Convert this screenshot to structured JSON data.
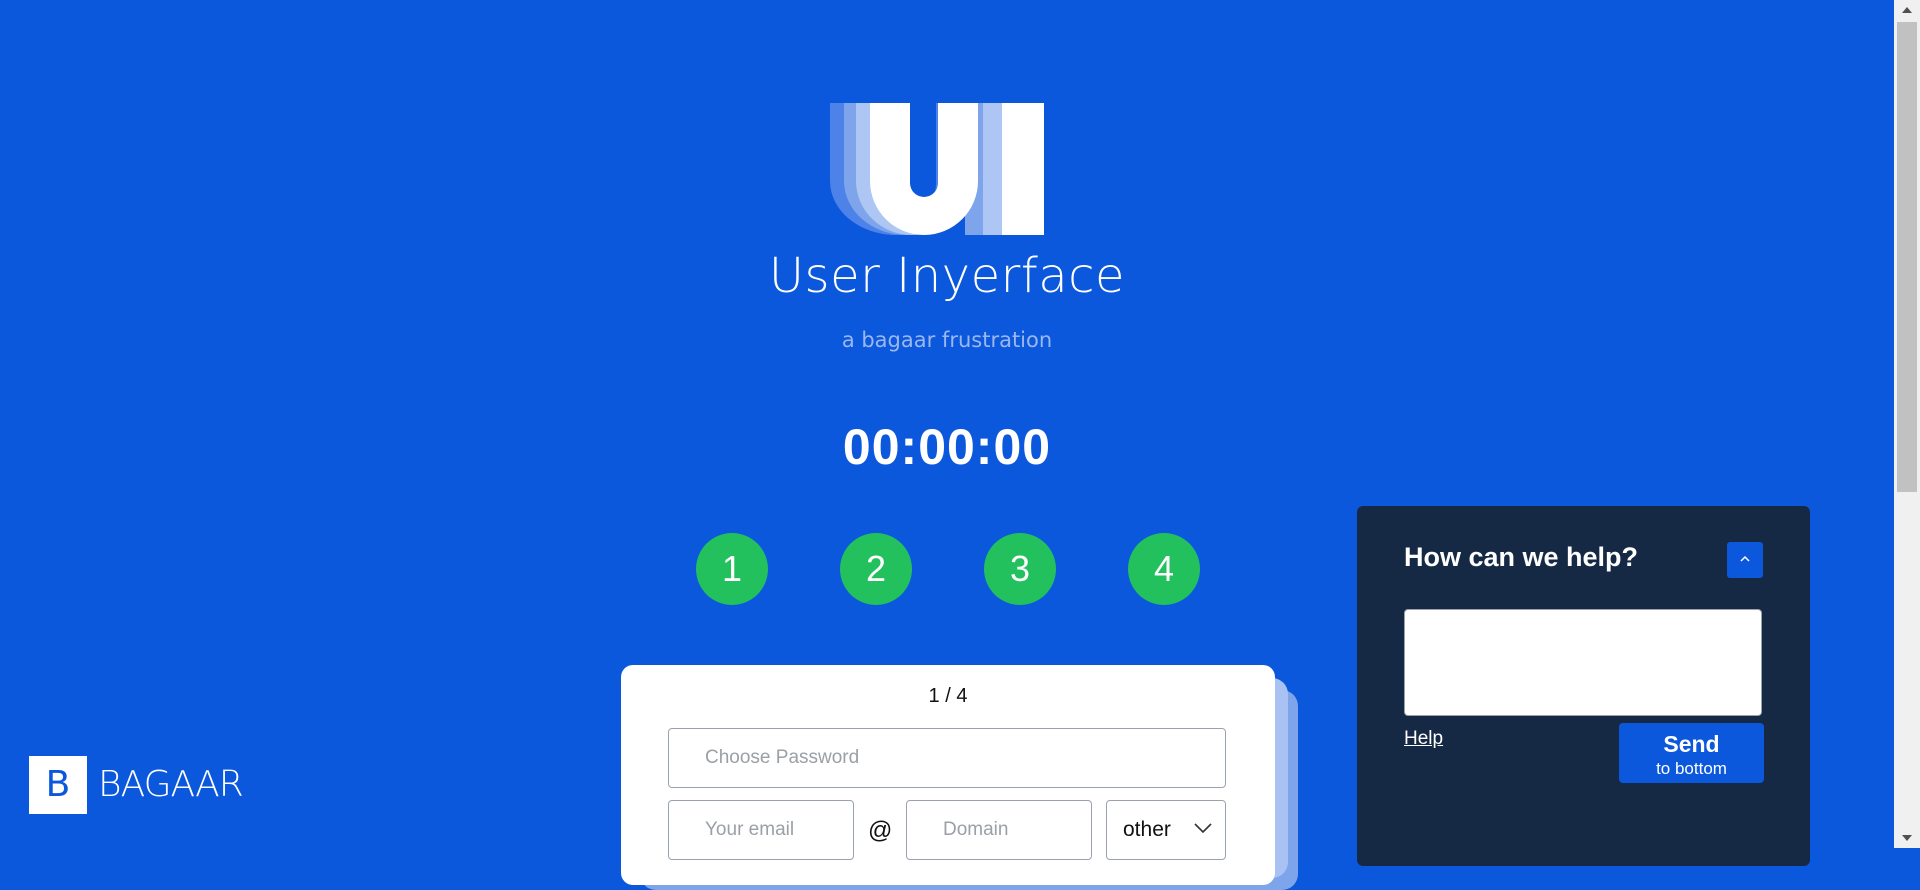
{
  "header": {
    "logo_text": "UI",
    "title": "User Inyerface",
    "subtitle": "a bagaar frustration"
  },
  "timer": "00:00:00",
  "steps": [
    "1",
    "2",
    "3",
    "4"
  ],
  "form": {
    "pager": "1 / 4",
    "password_placeholder": "Choose Password",
    "email_placeholder": "Your email",
    "at_sign": "@",
    "domain_placeholder": "Domain",
    "tld_selected": "other"
  },
  "help": {
    "title": "How can we help?",
    "link": "Help",
    "send_label": "Send",
    "send_sublabel": "to bottom"
  },
  "brand": {
    "box_letter": "B",
    "name": "BAGAAR"
  },
  "colors": {
    "background": "#0c58dd",
    "step": "#22c15d",
    "help_panel": "#152944"
  },
  "icons": {
    "help_toggle": "chevron-up-icon",
    "tld_dropdown": "chevron-down-icon"
  }
}
